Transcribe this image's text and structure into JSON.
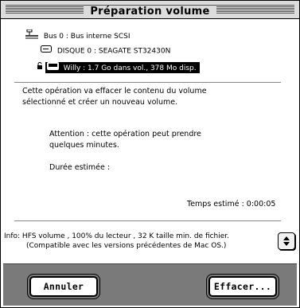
{
  "window": {
    "title": "Préparation volume"
  },
  "devices": {
    "bus_label": "Bus 0 : Bus interne SCSI",
    "disk_label": "DISQUE 0 :  SEAGATE ST32430N",
    "volume_label": "Willy : 1.7 Go dans vol., 378 Mo disp."
  },
  "message": {
    "line1": "Cette opération va effacer le contenu du volume",
    "line2": "sélectionné et créer un nouveau volume.",
    "warning_line1": "Attention : cette opération peut prendre",
    "warning_line2": "quelques minutes.",
    "duration_label": "Durée estimée :",
    "time_label": "Temps estimé  :  0:00:05"
  },
  "info": {
    "line1": "Info: HFS volume , 100% du lecteur , 32 K taille min. de fichier.",
    "line2": "(Compatible avec les versions précédentes de Mac OS.)"
  },
  "buttons": {
    "cancel": "Annuler",
    "erase": "Effacer..."
  },
  "colors": {
    "selection": "#000000",
    "button_bar": "#7a7a7a"
  },
  "icons": {
    "bus": "scsi-bus-icon",
    "disk": "hard-disk-icon",
    "volume": "volume-icon",
    "lock": "lock-icon",
    "popup": "popup-arrows-icon"
  }
}
